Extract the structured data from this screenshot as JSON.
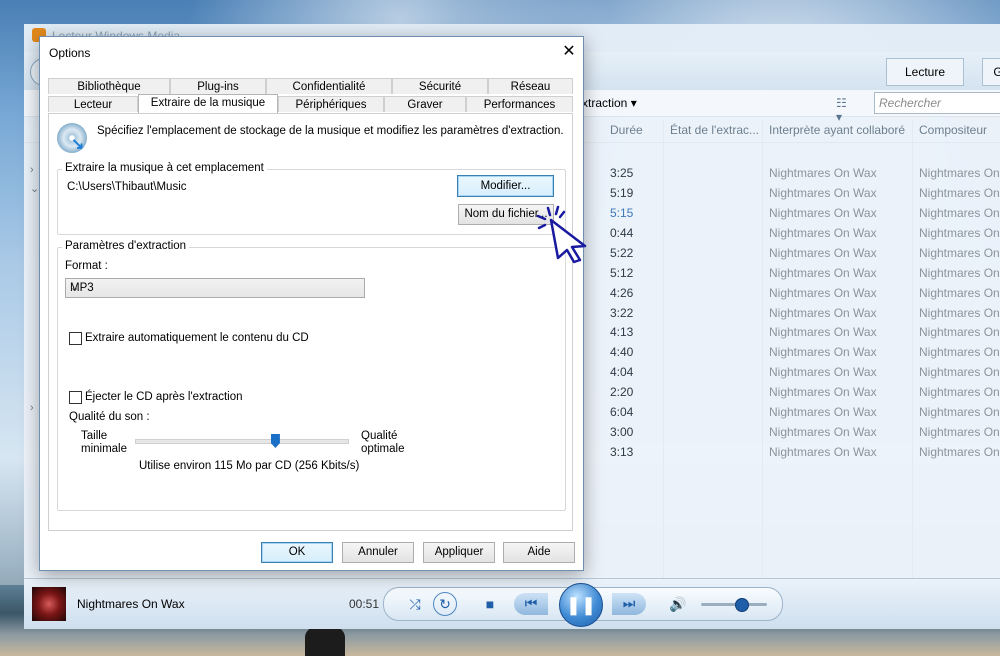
{
  "wmp": {
    "title": "Lecteur Windows Media",
    "tabs": [
      {
        "label": "Lecture"
      },
      {
        "label": "G"
      }
    ],
    "cmdbar": {
      "extraction_label": "xtraction",
      "search_placeholder": "Rechercher"
    },
    "columns": [
      "Durée",
      "État de l'extrac...",
      "Interprète ayant collaboré",
      "Compositeur"
    ],
    "rows": [
      {
        "duration": "3:25",
        "artist": "Nightmares On Wax",
        "composer": "Nightmares On"
      },
      {
        "duration": "5:19",
        "artist": "Nightmares On Wax",
        "composer": "Nightmares On"
      },
      {
        "duration": "5:15",
        "artist": "Nightmares On Wax",
        "composer": "Nightmares On"
      },
      {
        "duration": "0:44",
        "artist": "Nightmares On Wax",
        "composer": "Nightmares On"
      },
      {
        "duration": "5:22",
        "artist": "Nightmares On Wax",
        "composer": "Nightmares On"
      },
      {
        "duration": "5:12",
        "artist": "Nightmares On Wax",
        "composer": "Nightmares On"
      },
      {
        "duration": "4:26",
        "artist": "Nightmares On Wax",
        "composer": "Nightmares On"
      },
      {
        "duration": "3:22",
        "artist": "Nightmares On Wax",
        "composer": "Nightmares On"
      },
      {
        "duration": "4:13",
        "artist": "Nightmares On Wax",
        "composer": "Nightmares On"
      },
      {
        "duration": "4:40",
        "artist": "Nightmares On Wax",
        "composer": "Nightmares On"
      },
      {
        "duration": "4:04",
        "artist": "Nightmares On Wax",
        "composer": "Nightmares On"
      },
      {
        "duration": "2:20",
        "artist": "Nightmares On Wax",
        "composer": "Nightmares On"
      },
      {
        "duration": "6:04",
        "artist": "Nightmares On Wax",
        "composer": "Nightmares On"
      },
      {
        "duration": "3:00",
        "artist": "Nightmares On Wax",
        "composer": "Nightmares On"
      },
      {
        "duration": "3:13",
        "artist": "Nightmares On Wax",
        "composer": "Nightmares On"
      }
    ],
    "current_row_index": 2
  },
  "player": {
    "artist": "Nightmares On Wax",
    "elapsed": "00:51",
    "volume_fraction": 0.6
  },
  "dialog": {
    "title": "Options",
    "tabs_row1": [
      "Bibliothèque",
      "Plug-ins",
      "Confidentialité",
      "Sécurité",
      "Réseau"
    ],
    "tabs_row2": [
      "Lecteur",
      "Extraire de la musique",
      "Périphériques",
      "Graver",
      "Performances"
    ],
    "active_tab": "Extraire de la musique",
    "intro": "Spécifiez l'emplacement de stockage de la musique et modifiez les paramètres d'extraction.",
    "location_group": {
      "title": "Extraire la musique à cet emplacement",
      "path": "C:\\Users\\Thibaut\\Music",
      "modify_button": "Modifier...",
      "filename_button": "Nom du fichier..."
    },
    "settings_group": {
      "title": "Paramètres d'extraction",
      "format_label": "Format :",
      "format_value": "MP3",
      "auto_rip_label": "Extraire automatiquement le contenu du CD",
      "eject_label": "Éjecter le CD après l'extraction",
      "quality_label": "Qualité du son :",
      "quality_min": "Taille\nminimale",
      "quality_max": "Qualité\noptimale",
      "quality_info": "Utilise environ 115 Mo par CD (256 Kbits/s)",
      "quality_fraction": 0.66
    },
    "buttons": {
      "ok": "OK",
      "cancel": "Annuler",
      "apply": "Appliquer",
      "help": "Aide"
    }
  },
  "colors": {
    "accent": "#1f5ea8",
    "title_text": "#8aa3b8",
    "current_track": "#3d78b8"
  }
}
